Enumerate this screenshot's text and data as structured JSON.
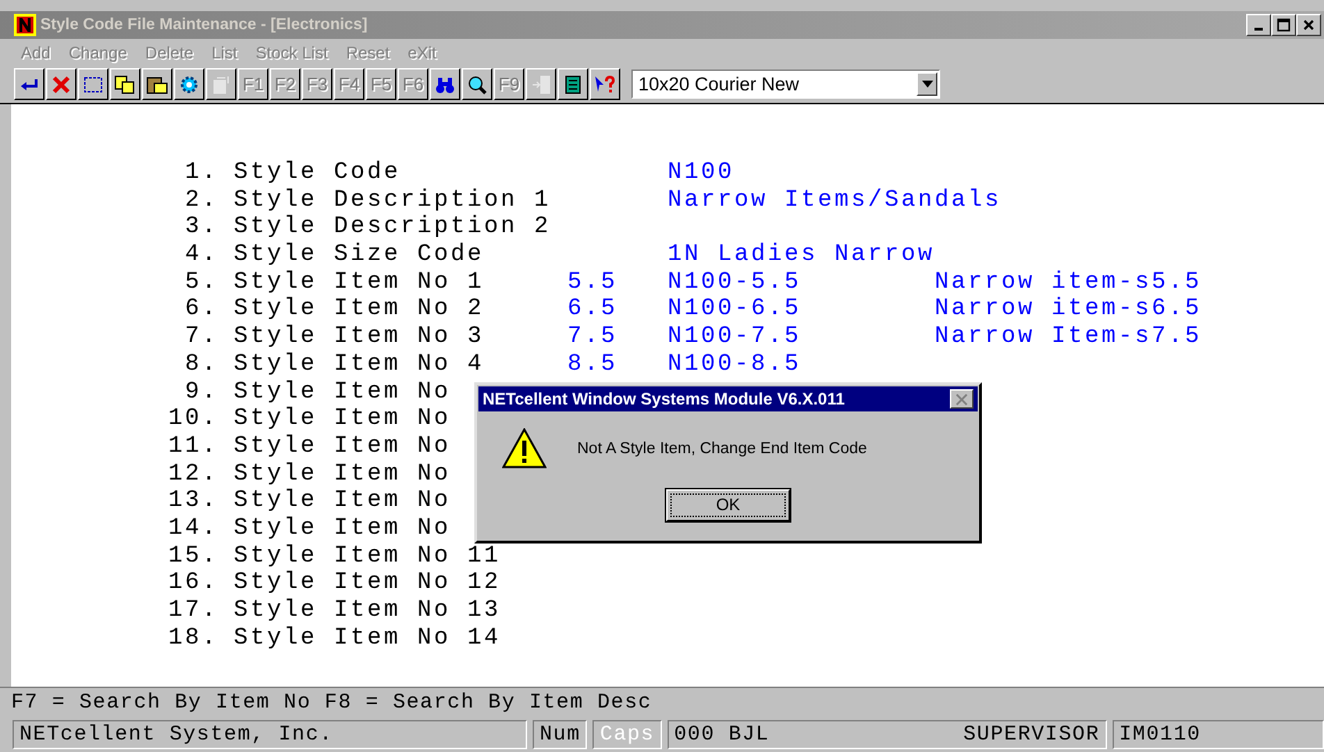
{
  "window": {
    "title": "Style Code File Maintenance - [Electronics]",
    "active": false
  },
  "menu": [
    {
      "label": "Add",
      "disabled": true
    },
    {
      "label": "Change",
      "disabled": true
    },
    {
      "label": "Delete",
      "disabled": true
    },
    {
      "label": "List",
      "disabled": true
    },
    {
      "label": "Stock List",
      "disabled": true
    },
    {
      "label": "Reset",
      "disabled": true
    },
    {
      "label": "eXit",
      "disabled": true
    }
  ],
  "toolbar": [
    {
      "kind": "enter",
      "disabled": false
    },
    {
      "kind": "cancel",
      "disabled": false
    },
    {
      "kind": "select",
      "disabled": false
    },
    {
      "kind": "copy",
      "disabled": false
    },
    {
      "kind": "paste",
      "disabled": false
    },
    {
      "kind": "gear",
      "disabled": false
    },
    {
      "kind": "document",
      "disabled": true
    },
    {
      "kind": "key",
      "label": "F1",
      "disabled": true
    },
    {
      "kind": "key",
      "label": "F2",
      "disabled": true
    },
    {
      "kind": "key",
      "label": "F3",
      "disabled": true
    },
    {
      "kind": "key",
      "label": "F4",
      "disabled": true
    },
    {
      "kind": "key",
      "label": "F5",
      "disabled": true
    },
    {
      "kind": "key",
      "label": "F6",
      "disabled": true
    },
    {
      "kind": "binoculars",
      "disabled": false
    },
    {
      "kind": "magnifier",
      "disabled": false
    },
    {
      "kind": "key",
      "label": "F9",
      "disabled": true
    },
    {
      "kind": "door",
      "disabled": true
    },
    {
      "kind": "list",
      "disabled": false
    },
    {
      "kind": "help",
      "disabled": false
    }
  ],
  "font_select": {
    "value": "10x20 Courier New"
  },
  "fields": [
    {
      "num": "1.",
      "label": "Style Code",
      "value": "N100"
    },
    {
      "num": "2.",
      "label": "Style Description 1",
      "value": "Narrow Items/Sandals"
    },
    {
      "num": "3.",
      "label": "Style Description 2"
    },
    {
      "num": "4.",
      "label": "Style Size Code",
      "value": "1N Ladies Narrow"
    },
    {
      "num": "5.",
      "label": "Style Item No 1",
      "size": "5.5",
      "value": "N100-5.5",
      "desc": "Narrow item-s5.5"
    },
    {
      "num": "6.",
      "label": "Style Item No 2",
      "size": "6.5",
      "value": "N100-6.5",
      "desc": "Narrow item-s6.5"
    },
    {
      "num": "7.",
      "label": "Style Item No 3",
      "size": "7.5",
      "value": "N100-7.5",
      "desc": "Narrow Item-s7.5"
    },
    {
      "num": "8.",
      "label": "Style Item No 4",
      "size": "8.5",
      "value": "N100-8.5"
    },
    {
      "num": "9.",
      "label": "Style Item No"
    },
    {
      "num": "10.",
      "label": "Style Item No"
    },
    {
      "num": "11.",
      "label": "Style Item No"
    },
    {
      "num": "12.",
      "label": "Style Item No"
    },
    {
      "num": "13.",
      "label": "Style Item No"
    },
    {
      "num": "14.",
      "label": "Style Item No"
    },
    {
      "num": "15.",
      "label": "Style Item No 11"
    },
    {
      "num": "16.",
      "label": "Style Item No 12"
    },
    {
      "num": "17.",
      "label": "Style Item No 13"
    },
    {
      "num": "18.",
      "label": "Style Item No 14"
    }
  ],
  "dialog": {
    "title": "NETcellent Window Systems Module V6.X.011",
    "message": "Not A Style Item, Change End Item Code",
    "button": "OK"
  },
  "hint_bar": "F7 = Search By Item No  F8 = Search By Item Desc",
  "status_bar": [
    {
      "kind": "panel",
      "text": "NETcellent System, Inc."
    },
    {
      "kind": "indicator",
      "text": "Num",
      "on": true
    },
    {
      "kind": "indicator",
      "text": "Caps",
      "on": false
    },
    {
      "kind": "split",
      "text": "000 BJL",
      "text_2": "SUPERVISOR"
    },
    {
      "kind": "panel",
      "text": "IM0110"
    }
  ]
}
